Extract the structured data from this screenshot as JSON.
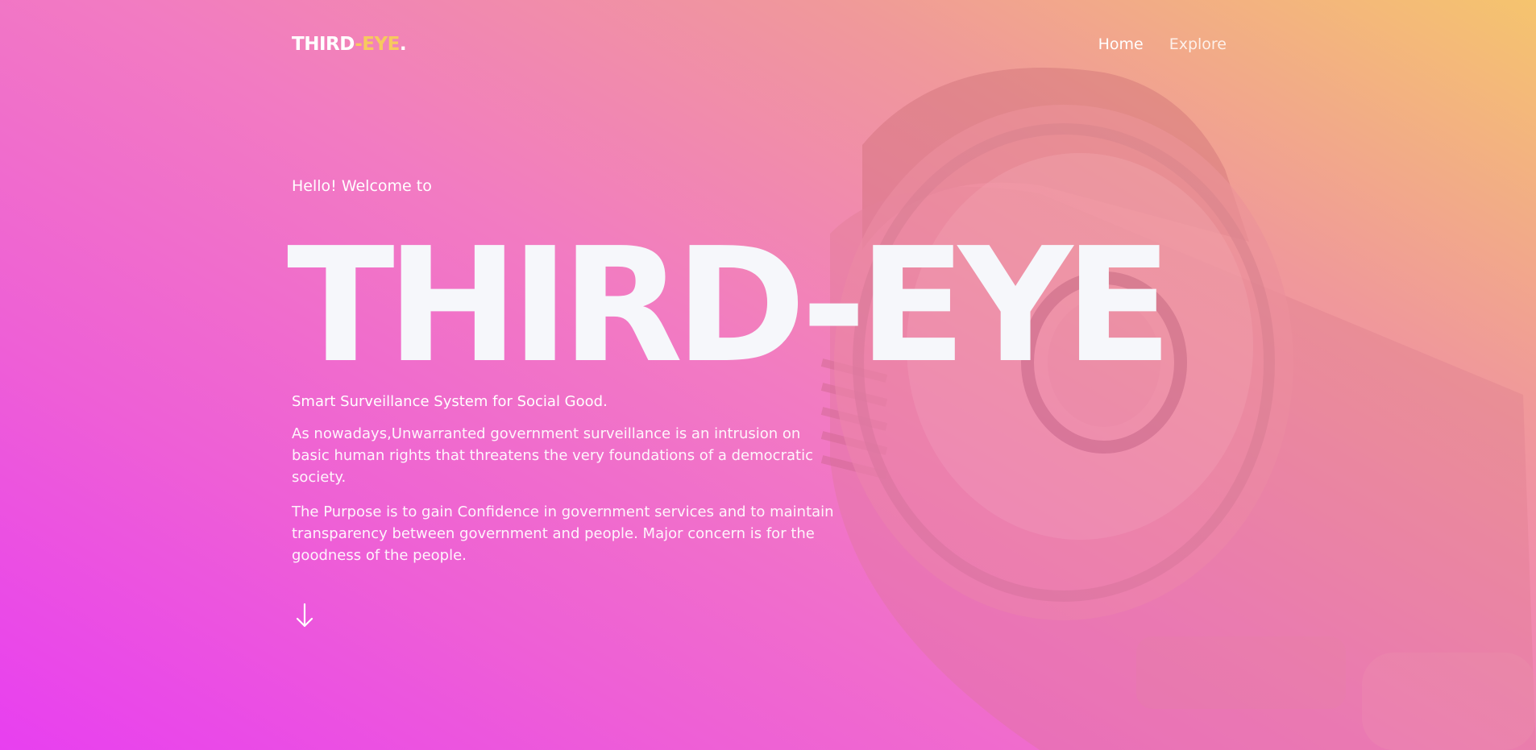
{
  "brand": {
    "part1": "THIRD",
    "dash": "-",
    "part2": "EYE",
    "dot": "."
  },
  "nav": {
    "items": [
      {
        "label": "Home"
      },
      {
        "label": "Explore"
      }
    ]
  },
  "hero": {
    "welcome": "Hello! Welcome to",
    "title": "THIRD-EYE",
    "tagline": "Smart Surveillance System for Social Good.",
    "paragraph1": "As nowadays,Unwarranted government surveillance is an intrusion on basic human rights that threatens the very foundations of a democratic society.",
    "paragraph2": "The Purpose is to gain Confidence in government services and to maintain transparency between government and people. Major concern is for the goodness of the people."
  },
  "icons": {
    "scroll": "arrow-down-icon",
    "background": "security-camera-icon"
  },
  "colors": {
    "gradient_start": "#e83ff0",
    "gradient_mid": "#f27bc2",
    "gradient_end": "#f5c46e",
    "logo_accent": "#f7c95e",
    "text": "#ffffff"
  }
}
